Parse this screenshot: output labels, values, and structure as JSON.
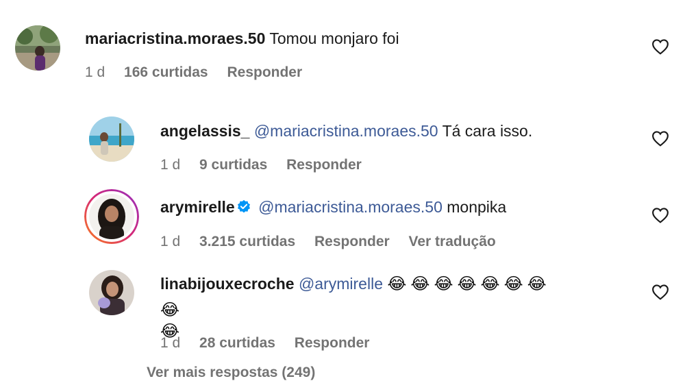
{
  "comments": [
    {
      "username": "mariacristina.moraes.50",
      "mention": "",
      "text": "Tomou monjaro foi",
      "time": "1 d",
      "likes": "166 curtidas",
      "reply": "Responder",
      "translate": "",
      "verified": false
    },
    {
      "username": "angelassis_",
      "mention": "@mariacristina.moraes.50",
      "text": "Tá cara isso.",
      "time": "1 d",
      "likes": "9 curtidas",
      "reply": "Responder",
      "translate": "",
      "verified": false
    },
    {
      "username": "arymirelle",
      "mention": "@mariacristina.moraes.50",
      "text": "monpika",
      "time": "1 d",
      "likes": "3.215 curtidas",
      "reply": "Responder",
      "translate": "Ver tradução",
      "verified": true
    },
    {
      "username": "linabijouxecroche",
      "mention": "@arymirelle",
      "text": "😂😂😂😂😂😂😂",
      "text_line2": "😂😂",
      "time": "1 d",
      "likes": "28 curtidas",
      "reply": "Responder",
      "translate": "",
      "verified": false
    }
  ],
  "view_more": "Ver mais respostas (249)",
  "colors": {
    "meta": "#737373",
    "mention": "#3d5a96",
    "verified": "#0095f6",
    "story_ring_a": "#d62976",
    "story_ring_b": "#fa7e1e"
  },
  "icons": {
    "like": "heart-outline-icon",
    "verified": "verified-badge-icon"
  }
}
